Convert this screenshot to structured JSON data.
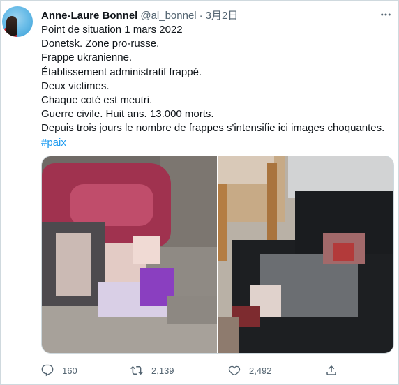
{
  "tweet": {
    "author_name": "Anne-Laure Bonnel",
    "handle": "@al_bonnel",
    "separator": "·",
    "date": "3月2日",
    "lines": [
      "Point de situation 1 mars 2022",
      "Donetsk. Zone pro-russe.",
      "Frappe ukranienne.",
      "Établissement administratif frappé.",
      "Deux victimes.",
      "Chaque coté est meutri.",
      "Guerre civile. Huit ans. 13.000 morts.",
      "Depuis trois jours le nombre de frappes s'intensifie ici images choquantes."
    ],
    "hashtag": "#paix"
  },
  "actions": {
    "reply_count": "160",
    "retweet_count": "2,139",
    "like_count": "2,492"
  },
  "icons": [
    "more-icon",
    "reply-icon",
    "retweet-icon",
    "like-icon",
    "share-icon"
  ],
  "colors": {
    "text": "#0f1419",
    "secondary": "#536471",
    "link": "#1d9bf0",
    "border": "#cfd9de"
  }
}
